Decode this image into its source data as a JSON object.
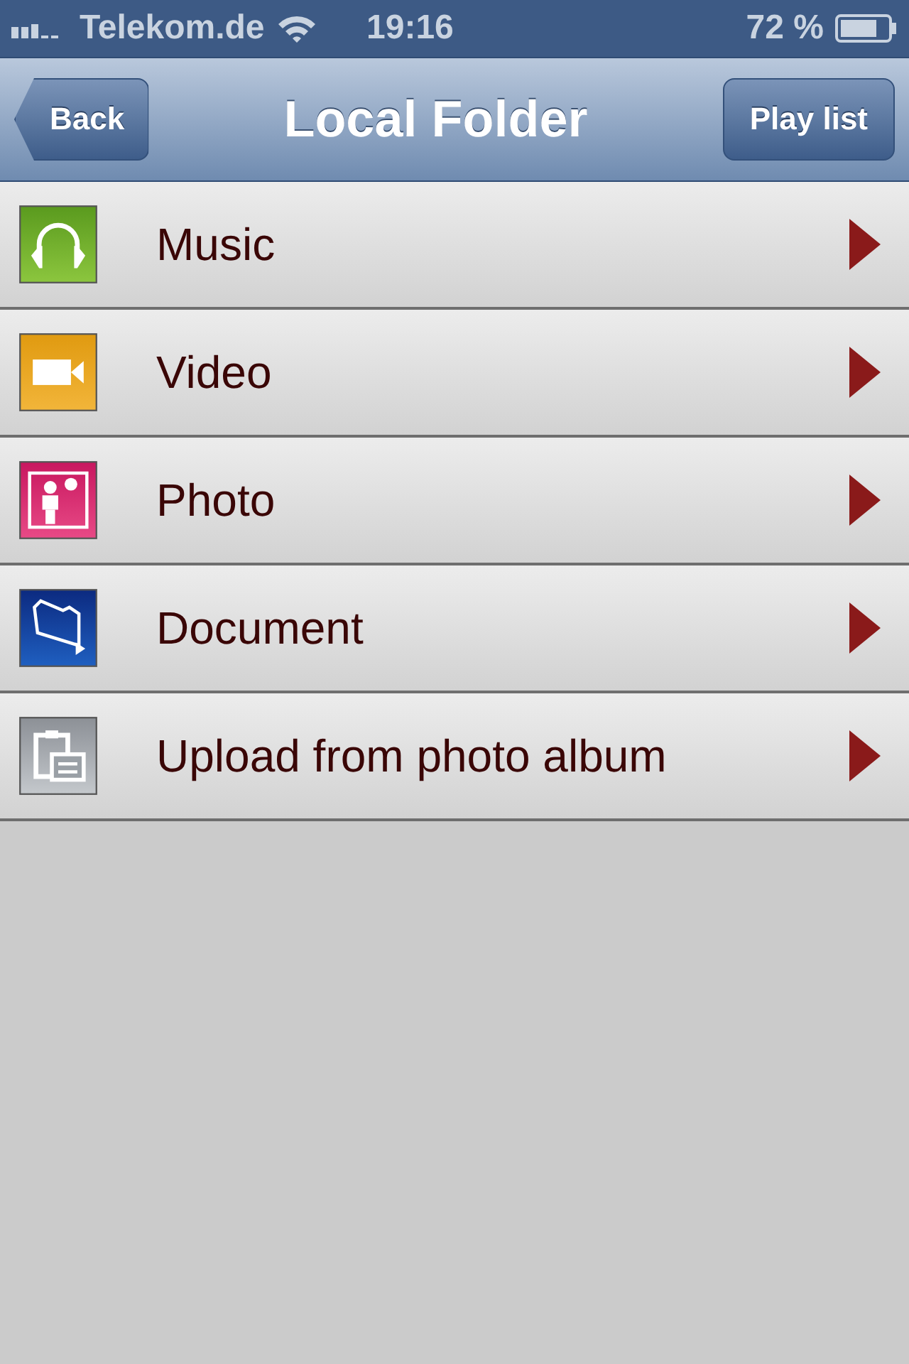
{
  "status_bar": {
    "carrier": "Telekom.de",
    "time": "19:16",
    "battery": "72 %"
  },
  "nav_bar": {
    "back": "Back",
    "title": "Local Folder",
    "action": "Play list"
  },
  "items": [
    {
      "kind": "music",
      "label": "Music"
    },
    {
      "kind": "video",
      "label": "Video"
    },
    {
      "kind": "photo",
      "label": "Photo"
    },
    {
      "kind": "document",
      "label": "Document"
    },
    {
      "kind": "upload",
      "label": "Upload from photo album"
    }
  ]
}
